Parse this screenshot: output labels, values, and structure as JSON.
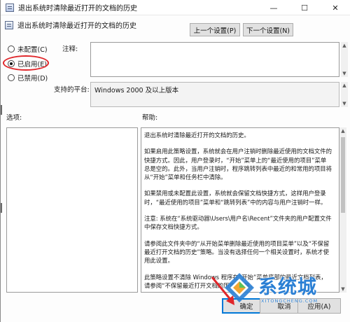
{
  "window": {
    "title": "退出系统时清除最近打开的文档的历史",
    "minimize": "—",
    "maximize": "☐",
    "close": "✕"
  },
  "policy": {
    "name": "退出系统时清除最近打开的文档的历史",
    "prev_button": "上一个设置(P)",
    "next_button": "下一个设置(N)"
  },
  "state": {
    "not_configured": "未配置(C)",
    "enabled": "已启用(E)",
    "disabled": "已禁用(D)",
    "selected": "enabled"
  },
  "comment_label": "注释:",
  "comment_value": "",
  "platform_label": "支持的平台:",
  "platform_value": "Windows 2000 及以上版本",
  "options_label": "选项:",
  "help_label": "帮助:",
  "help_paragraphs": [
    "退出系统时清除最近打开的文档的历史。",
    "如果启用此策略设置，系统就会在用户注销时删除最近使用的文档文件的快捷方式。因此，用户登录时，“开始”菜单上的“最近使用的项目”菜单总是空的。此外，当用户注销时，程序跳转列表中最近的和常用的项目将从“开始”菜单和任务栏中清除。",
    "如果禁用或未配置此设置，系统就会保留文档快捷方式，这样用户登录时，“最近使用的项目”菜单和“跳转列表”中的内容与用户注销时一样。",
    "注意: 系统在“系统驱动器\\Users\\用户名\\Recent”文件夹的用户配置文件中保存文档快捷方式。",
    "请参阅此文件夹中的“从开始菜单删除最近使用的项目菜单”以及“不保留最近打开文档的历史”策略。当没有选择任何一个相关设置时，系统才使用此设置。",
    "此策略设置不清除 Windows 程序在“开始”菜单底部的最近文档列表，请参阅“不保留最近打开文档的历史”策略。"
  ],
  "footer": {
    "ok": "确定",
    "cancel": "取消",
    "apply": "应用(A)"
  },
  "watermark": {
    "text": "系统城",
    "sub": "XITONGCHENG.COM"
  },
  "colors": {
    "highlight_ellipse": "#e0262a",
    "ok_border": "#0078d7",
    "watermark_blue": "#2a7fd4"
  }
}
